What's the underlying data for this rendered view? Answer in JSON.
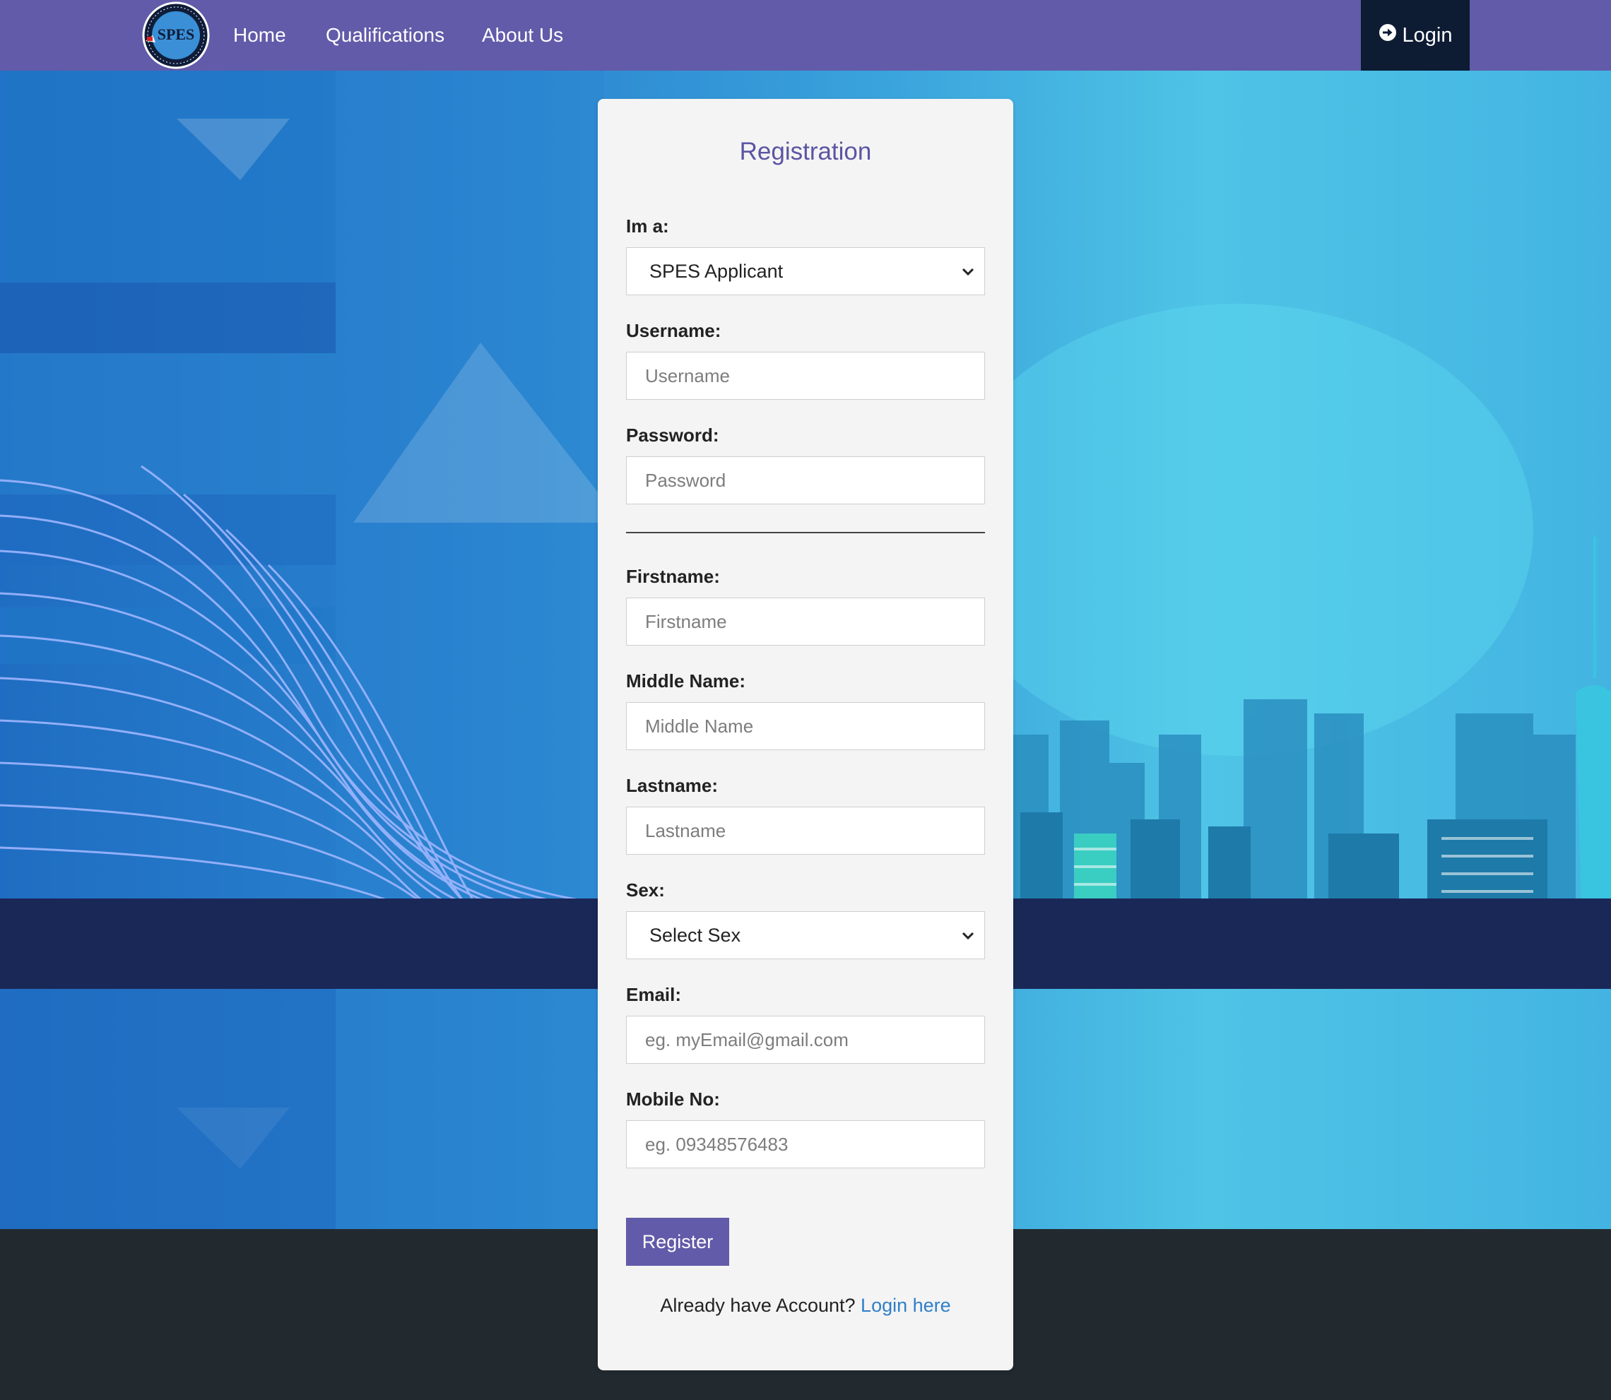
{
  "nav": {
    "links": [
      "Home",
      "Qualifications",
      "About Us"
    ],
    "login_label": "Login",
    "logo_text": "SPES"
  },
  "form": {
    "title": "Registration",
    "role": {
      "label": "Im a:",
      "selected": "SPES Applicant"
    },
    "username": {
      "label": "Username:",
      "placeholder": "Username"
    },
    "password": {
      "label": "Password:",
      "placeholder": "Password"
    },
    "firstname": {
      "label": "Firstname:",
      "placeholder": "Firstname"
    },
    "middlename": {
      "label": "Middle Name:",
      "placeholder": "Middle Name"
    },
    "lastname": {
      "label": "Lastname:",
      "placeholder": "Lastname"
    },
    "sex": {
      "label": "Sex:",
      "selected": "Select Sex"
    },
    "email": {
      "label": "Email:",
      "placeholder": "eg. myEmail@gmail.com"
    },
    "mobile": {
      "label": "Mobile No:",
      "placeholder": "eg. 09348576483"
    },
    "register_label": "Register",
    "account_prompt": "Already have Account?",
    "login_link": "Login here"
  },
  "colors": {
    "nav_bg": "#625ba9",
    "login_bg": "#0d1b33",
    "accent": "#625ba9",
    "link": "#2f7fc7",
    "navy_band": "#1a2858",
    "footer": "#222a30"
  },
  "icons": {
    "login": "sign-in-circle-arrow-icon",
    "select": "chevron-down-icon"
  }
}
